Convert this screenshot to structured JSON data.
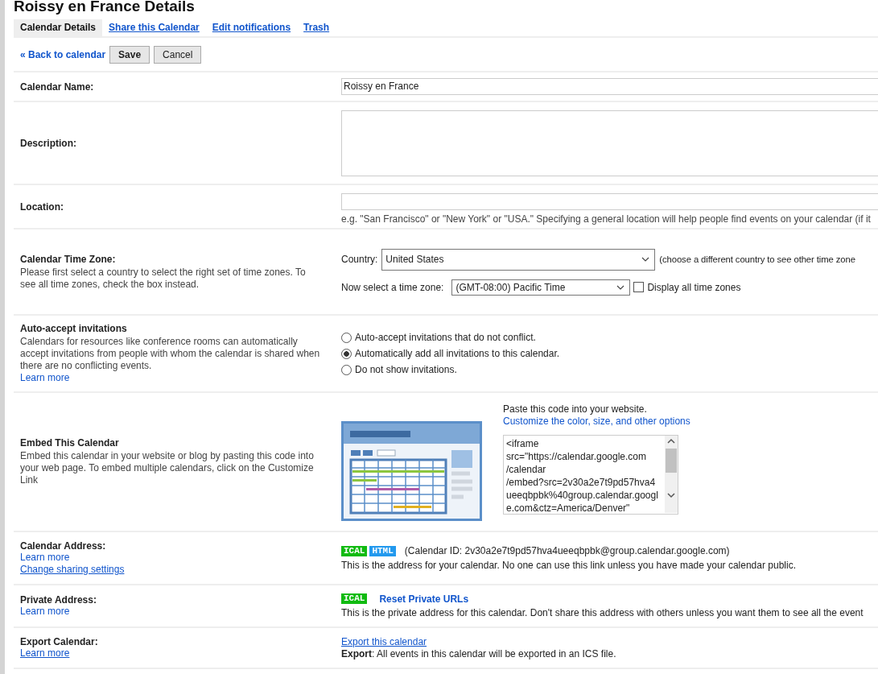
{
  "title": "Roissy en France Details",
  "tabs": [
    {
      "label": "Calendar Details",
      "selected": true
    },
    {
      "label": "Share this Calendar",
      "selected": false
    },
    {
      "label": "Edit notifications",
      "selected": false
    },
    {
      "label": "Trash",
      "selected": false
    }
  ],
  "toolbar": {
    "back_link": "« Back to calendar",
    "buttons": [
      {
        "label": "Save",
        "primary": true
      },
      {
        "label": "Cancel",
        "primary": false
      }
    ]
  },
  "rows": [
    {
      "kind": "text",
      "label": "Calendar Name:",
      "value": "Roissy en France"
    },
    {
      "kind": "textarea",
      "label": "Description:"
    },
    {
      "kind": "location",
      "label": "Location:",
      "hint": "e.g. \"San Francisco\" or \"New York\" or \"USA.\" Specifying a general location will help people find events on your calendar (if it"
    },
    {
      "kind": "timezone",
      "label": "Calendar Time Zone:",
      "description": "Please first select a country to select the right set of time zones. To see all time zones, check the box instead.",
      "country_label": "Country:",
      "country": "United States",
      "country_note": "(choose a different country to see other time zone",
      "zone_label": "Now select a time zone:",
      "zone": "(GMT-08:00) Pacific Time",
      "display_all": {
        "label": "Display all time zones",
        "checked": false
      }
    },
    {
      "kind": "radios",
      "label": "Auto-accept invitations",
      "description": "Calendars for resources like conference rooms can automatically accept invitations from people with whom the calendar is shared when there are no conflicting events.",
      "links": [
        {
          "text": "Learn more",
          "underline": false
        }
      ],
      "options": [
        {
          "label": "Auto-accept invitations that do not conflict.",
          "selected": false
        },
        {
          "label": "Automatically add all invitations to this calendar.",
          "selected": true
        },
        {
          "label": "Do not show invitations.",
          "selected": false
        }
      ]
    },
    {
      "kind": "embed",
      "label": "Embed This Calendar",
      "description": "Embed this calendar in your website or blog by pasting this code into your web page. To embed multiple calendars, click on the Customize Link",
      "instruction": "Paste this code into your website.",
      "customize_link": "Customize the color, size, and other options",
      "code_lines": [
        "<iframe",
        "src=\"https://calendar.google.com",
        "/calendar",
        "/embed?src=2v30a2e7t9pd57hva4",
        "ueeqbpbk%40group.calendar.googl",
        "e.com&ctz=America/Denver\""
      ]
    },
    {
      "kind": "address",
      "label": "Calendar Address:",
      "links": [
        {
          "text": "Learn more",
          "underline": false
        },
        {
          "text": "Change sharing settings",
          "underline": true
        }
      ],
      "badges": [
        {
          "text": "ICAL",
          "color": "#11bb11"
        },
        {
          "text": "HTML",
          "color": "#2299ee"
        }
      ],
      "detail": "(Calendar ID: 2v30a2e7t9pd57hva4ueeqbpbk@group.calendar.google.com)",
      "note": "This is the address for your calendar. No one can use this link unless you have made your calendar public."
    },
    {
      "kind": "private",
      "label": "Private Address:",
      "links": [
        {
          "text": "Learn more",
          "underline": false
        }
      ],
      "badges": [
        {
          "text": "ICAL",
          "color": "#11bb11"
        }
      ],
      "action": "Reset Private URLs",
      "note": "This is the private address for this calendar. Don't share this address with others unless you want them to see all the event"
    },
    {
      "kind": "export",
      "label": "Export Calendar:",
      "links": [
        {
          "text": "Learn more",
          "underline": true
        }
      ],
      "action": "Export this calendar",
      "note": "**Export**: All events in this calendar will be exported in an ICS file."
    }
  ]
}
